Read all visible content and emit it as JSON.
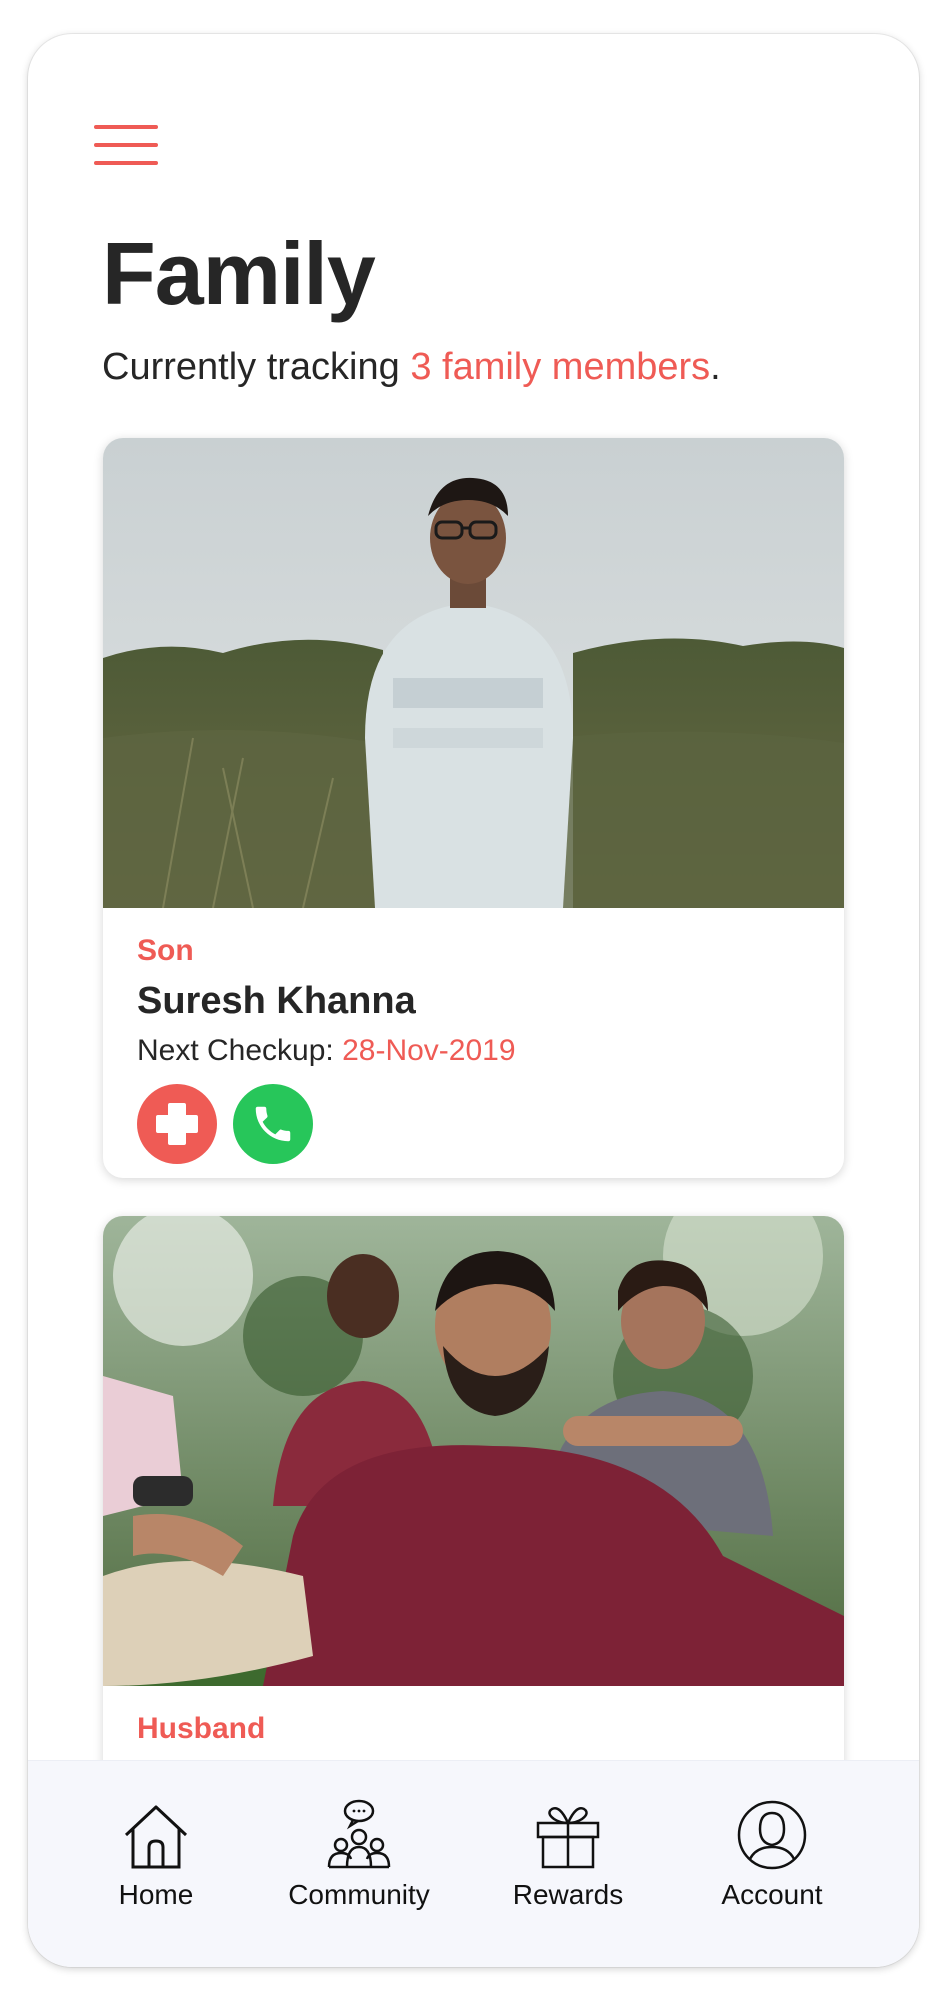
{
  "header": {
    "title": "Family",
    "subtitle_prefix": "Currently tracking ",
    "subtitle_highlight": "3 family members",
    "subtitle_suffix": "."
  },
  "members": [
    {
      "relation": "Son",
      "name": "Suresh Khanna",
      "checkup_label": "Next Checkup: ",
      "checkup_date": "28-Nov-2019",
      "photo": "young-man-in-field-photo",
      "actions": [
        "medical-cross-icon",
        "phone-icon"
      ]
    },
    {
      "relation": "Husband",
      "photo": "group-outdoors-photo"
    }
  ],
  "tabbar": {
    "items": [
      {
        "label": "Home",
        "icon": "home-icon"
      },
      {
        "label": "Community",
        "icon": "community-icon"
      },
      {
        "label": "Rewards",
        "icon": "gift-icon"
      },
      {
        "label": "Account",
        "icon": "account-icon"
      }
    ]
  },
  "colors": {
    "accent": "#ef5b55",
    "call": "#27c65a",
    "text": "#262626",
    "tabbar_bg": "#f6f7fc"
  }
}
